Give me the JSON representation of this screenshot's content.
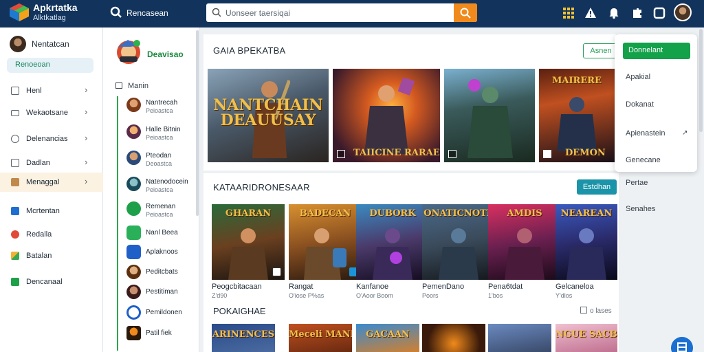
{
  "app": {
    "title": "Apkrtatka",
    "subtitle": "Alktkatlag"
  },
  "nav": {
    "label": "Rencasean"
  },
  "search": {
    "placeholder": "Uonseer taersiqai"
  },
  "sidebar": {
    "profile": {
      "name": "Nentatcan",
      "pill": "Renoeoan"
    },
    "items": [
      {
        "label": "Henl",
        "icon": "grid-icon",
        "chevron": true
      },
      {
        "label": "Wekaotsane",
        "icon": "monitor-icon",
        "chevron": true
      },
      {
        "label": "Delenancias",
        "icon": "disc-icon",
        "chevron": true
      },
      {
        "label": "Dadlan",
        "icon": "folder-icon",
        "chevron": true
      },
      {
        "label": "Menaggal",
        "icon": "box-icon",
        "chevron": true,
        "active": true
      },
      {
        "label": "Mcrtentan",
        "icon": "chart-icon"
      },
      {
        "label": "Redalla",
        "icon": "record-icon"
      },
      {
        "label": "Batalan",
        "icon": "image-icon"
      },
      {
        "label": "Dencanaal",
        "icon": "download-icon"
      }
    ]
  },
  "midcol": {
    "title": "Deavisao",
    "section": "Manin",
    "items": [
      {
        "name": "Nantrecah",
        "meta": "Peioastca"
      },
      {
        "name": "Halle Bitnin",
        "meta": "Peioastca"
      },
      {
        "name": "Pteodan",
        "meta": "Deoastca"
      },
      {
        "name": "Natenodocein",
        "meta": "Peioastca"
      },
      {
        "name": "Remenan",
        "meta": "Peioastca"
      },
      {
        "name": "Nanl Beea",
        "meta": ""
      },
      {
        "name": "Aplaknoos",
        "meta": ""
      },
      {
        "name": "Peditcbats",
        "meta": ""
      },
      {
        "name": "Pestitiman",
        "meta": ""
      },
      {
        "name": "Pemildonen",
        "meta": ""
      },
      {
        "name": "Patil fiek",
        "meta": ""
      }
    ]
  },
  "main": {
    "section1": {
      "title": "GAIA BPEKATBA",
      "button": "Asnen"
    },
    "banners": [
      {
        "title": "NANTCHAIN\nDEAUUSAY",
        "caption": ""
      },
      {
        "title": "",
        "caption": "TAIICINE RARAE"
      },
      {
        "title": "",
        "caption": ""
      },
      {
        "title": "MAIRERE",
        "caption": "DEMON"
      }
    ],
    "section2": {
      "title": "KATAARIDRONESAAR",
      "button": "Estdhan"
    },
    "tiles": [
      {
        "title": "GHARAN",
        "name": "Peogcbitacaan",
        "meta": "Z'd90"
      },
      {
        "title": "BADECAN",
        "name": "Rangat",
        "meta": "O'iose P%as"
      },
      {
        "title": "DUBORK",
        "name": "Kanfanoe",
        "meta": "O'Aoor Boom"
      },
      {
        "title": "ONATICNOTE",
        "name": "PemenDano",
        "meta": "Poors"
      },
      {
        "title": "AMDIS",
        "name": "Pena6tdat",
        "meta": "1'bos"
      },
      {
        "title": "NEAREAN",
        "name": "Gelcaneloa",
        "meta": "Y'dlos"
      }
    ],
    "section3": {
      "title": "POKAIGHAE",
      "right": "o lases"
    },
    "tiles_bottom": [
      "ARINENCES",
      "Meceli MANK",
      "GACAAN",
      "",
      "",
      "NGUE SACB"
    ],
    "right_labels": [
      "Pertae",
      "Senahes"
    ]
  },
  "dropdown": {
    "items": [
      "Donnelant",
      "Apakial",
      "Dokanat",
      "Apienastein",
      "Genecane"
    ]
  },
  "colors": {
    "topbar": "#12345c",
    "accent_orange": "#f08a1c",
    "accent_green": "#13a14a",
    "accent_teal": "#1b93a8"
  }
}
